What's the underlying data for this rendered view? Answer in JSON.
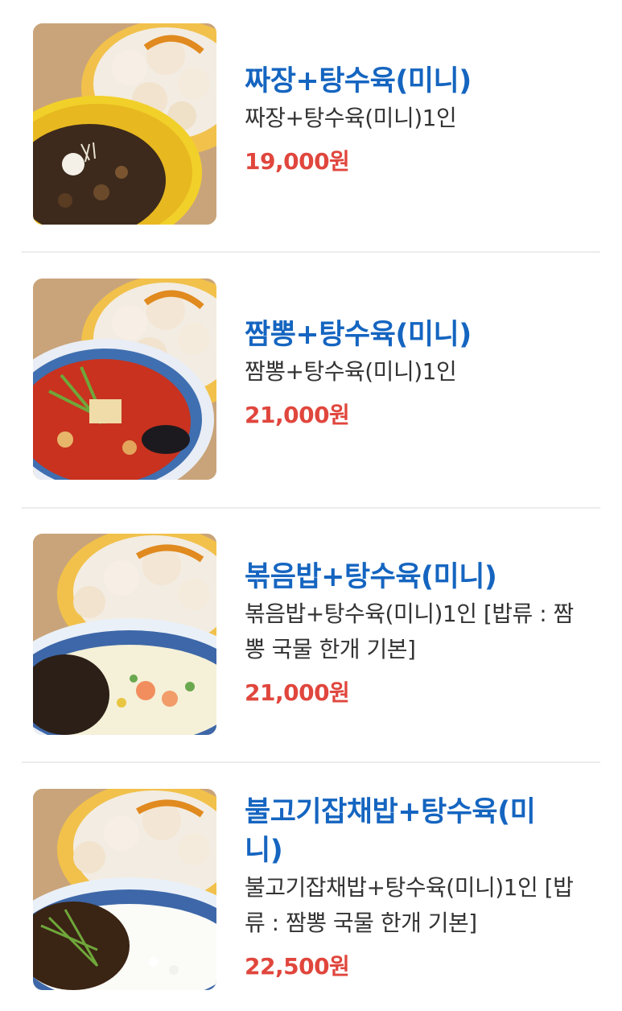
{
  "menu": {
    "items": [
      {
        "title": "짜장+탕수육(미니)",
        "description": "짜장+탕수육(미니)1인",
        "price": "19,000원",
        "image_icon": "jajang-tangsuyuk-photo"
      },
      {
        "title": "짬뽕+탕수육(미니)",
        "description": "짬뽕+탕수육(미니)1인",
        "price": "21,000원",
        "image_icon": "jjamppong-tangsuyuk-photo"
      },
      {
        "title": "볶음밥+탕수육(미니)",
        "description": "볶음밥+탕수육(미니)1인 [밥류 : 짬뽕 국물 한개 기본]",
        "price": "21,000원",
        "image_icon": "fried-rice-tangsuyuk-photo"
      },
      {
        "title": "불고기잡채밥+탕수육(미니)",
        "description": "불고기잡채밥+탕수육(미니)1인 [밥류 : 짬뽕 국물 한개 기본]",
        "price": "22,500원",
        "image_icon": "bulgogi-japchae-rice-tangsuyuk-photo"
      }
    ]
  },
  "colors": {
    "title": "#1565c0",
    "price": "#e0463d",
    "description": "#333333",
    "divider": "#ececec"
  }
}
